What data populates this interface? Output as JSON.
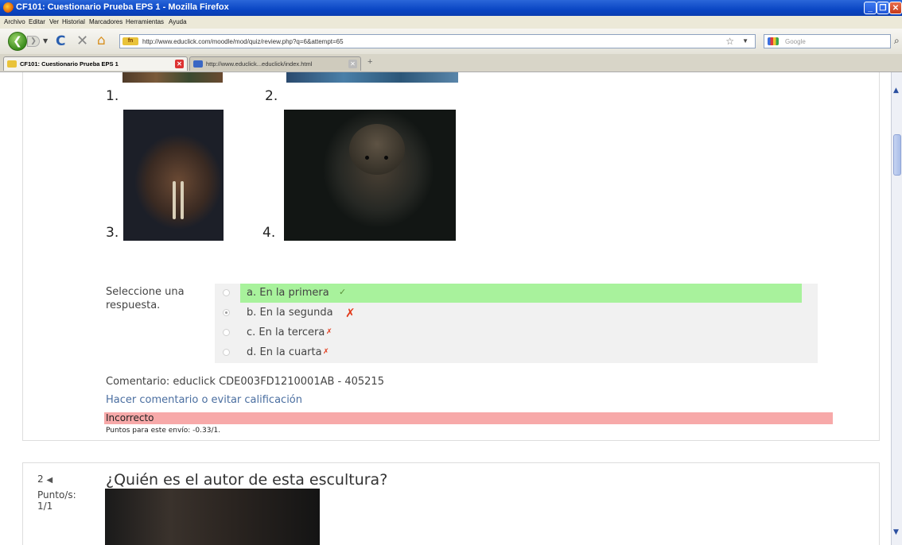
{
  "window": {
    "title": "CF101: Cuestionario Prueba EPS 1 - Mozilla Firefox"
  },
  "menu": [
    "Archivo",
    "Editar",
    "Ver",
    "Historial",
    "Marcadores",
    "Herramientas",
    "Ayuda"
  ],
  "address": {
    "site_badge": "fn",
    "url": "http://www.educlick.com/moodle/mod/quiz/review.php?q=6&attempt=65",
    "search_placeholder": "Google"
  },
  "tabs": [
    {
      "label": "CF101: Cuestionario Prueba EPS 1",
      "active": true
    },
    {
      "label": "http://www.educlick...educlick/index.html",
      "active": false
    }
  ],
  "question1": {
    "image_numbers": [
      "1.",
      "2.",
      "3.",
      "4."
    ],
    "select_label": "Seleccione una respuesta.",
    "answers": [
      {
        "text": "a. En la primera",
        "mark": "✓",
        "status": "correct",
        "selected": false
      },
      {
        "text": "b. En la segunda",
        "mark": "✗",
        "status": "wrong-selected",
        "selected": true
      },
      {
        "text": "c. En la tercera",
        "mark": "✗",
        "status": "wrong",
        "selected": false
      },
      {
        "text": "d. En la cuarta",
        "mark": "✗",
        "status": "wrong",
        "selected": false
      }
    ],
    "comment": "Comentario: educlick CDE003FD1210001AB - 405215",
    "comment_link": "Hacer comentario o evitar calificación",
    "result": "Incorrecto",
    "points": "Puntos para este envío: -0.33/1."
  },
  "question2": {
    "number": "2",
    "points_label": "Punto/s:",
    "points_value": "1/1",
    "text": "¿Quién es el autor de esta escultura?"
  }
}
